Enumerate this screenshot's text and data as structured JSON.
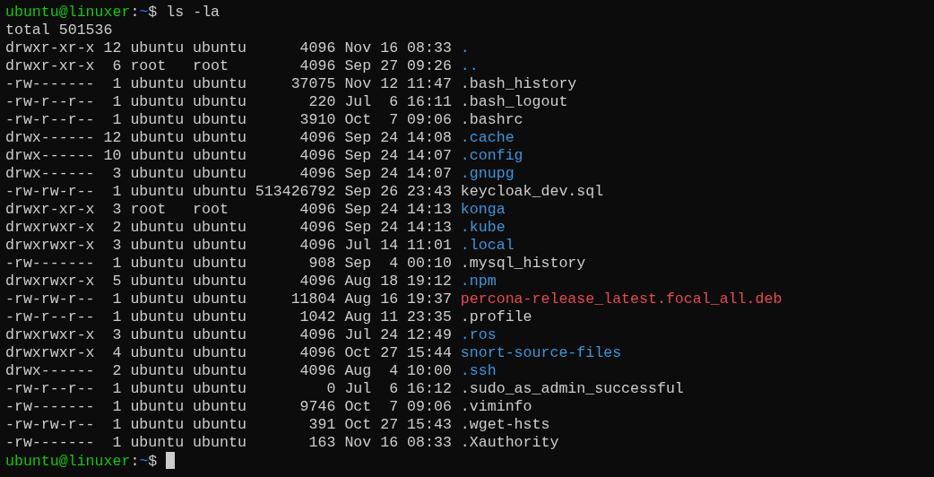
{
  "prompts": [
    {
      "user_host": "ubuntu@linuxer",
      "separator": ":",
      "path": "~",
      "symbol": "$",
      "command": "ls -la"
    }
  ],
  "total": "total 501536",
  "entries": [
    {
      "perms": "drwxr-xr-x",
      "links": "12",
      "owner": "ubuntu",
      "group": "ubuntu",
      "size": "4096",
      "month": "Nov",
      "day": "16",
      "time": "08:33",
      "name": ".",
      "kind": "dir"
    },
    {
      "perms": "drwxr-xr-x",
      "links": "6",
      "owner": "root",
      "group": "root",
      "size": "4096",
      "month": "Sep",
      "day": "27",
      "time": "09:26",
      "name": "..",
      "kind": "dir"
    },
    {
      "perms": "-rw-------",
      "links": "1",
      "owner": "ubuntu",
      "group": "ubuntu",
      "size": "37075",
      "month": "Nov",
      "day": "12",
      "time": "11:47",
      "name": ".bash_history",
      "kind": "file"
    },
    {
      "perms": "-rw-r--r--",
      "links": "1",
      "owner": "ubuntu",
      "group": "ubuntu",
      "size": "220",
      "month": "Jul",
      "day": "6",
      "time": "16:11",
      "name": ".bash_logout",
      "kind": "file"
    },
    {
      "perms": "-rw-r--r--",
      "links": "1",
      "owner": "ubuntu",
      "group": "ubuntu",
      "size": "3910",
      "month": "Oct",
      "day": "7",
      "time": "09:06",
      "name": ".bashrc",
      "kind": "file"
    },
    {
      "perms": "drwx------",
      "links": "12",
      "owner": "ubuntu",
      "group": "ubuntu",
      "size": "4096",
      "month": "Sep",
      "day": "24",
      "time": "14:08",
      "name": ".cache",
      "kind": "dir"
    },
    {
      "perms": "drwx------",
      "links": "10",
      "owner": "ubuntu",
      "group": "ubuntu",
      "size": "4096",
      "month": "Sep",
      "day": "24",
      "time": "14:07",
      "name": ".config",
      "kind": "dir"
    },
    {
      "perms": "drwx------",
      "links": "3",
      "owner": "ubuntu",
      "group": "ubuntu",
      "size": "4096",
      "month": "Sep",
      "day": "24",
      "time": "14:07",
      "name": ".gnupg",
      "kind": "dir"
    },
    {
      "perms": "-rw-rw-r--",
      "links": "1",
      "owner": "ubuntu",
      "group": "ubuntu",
      "size": "513426792",
      "month": "Sep",
      "day": "26",
      "time": "23:43",
      "name": "keycloak_dev.sql",
      "kind": "file"
    },
    {
      "perms": "drwxr-xr-x",
      "links": "3",
      "owner": "root",
      "group": "root",
      "size": "4096",
      "month": "Sep",
      "day": "24",
      "time": "14:13",
      "name": "konga",
      "kind": "dir"
    },
    {
      "perms": "drwxrwxr-x",
      "links": "2",
      "owner": "ubuntu",
      "group": "ubuntu",
      "size": "4096",
      "month": "Sep",
      "day": "24",
      "time": "14:13",
      "name": ".kube",
      "kind": "dir"
    },
    {
      "perms": "drwxrwxr-x",
      "links": "3",
      "owner": "ubuntu",
      "group": "ubuntu",
      "size": "4096",
      "month": "Jul",
      "day": "14",
      "time": "11:01",
      "name": ".local",
      "kind": "dir"
    },
    {
      "perms": "-rw-------",
      "links": "1",
      "owner": "ubuntu",
      "group": "ubuntu",
      "size": "908",
      "month": "Sep",
      "day": "4",
      "time": "00:10",
      "name": ".mysql_history",
      "kind": "file"
    },
    {
      "perms": "drwxrwxr-x",
      "links": "5",
      "owner": "ubuntu",
      "group": "ubuntu",
      "size": "4096",
      "month": "Aug",
      "day": "18",
      "time": "19:12",
      "name": ".npm",
      "kind": "dir"
    },
    {
      "perms": "-rw-rw-r--",
      "links": "1",
      "owner": "ubuntu",
      "group": "ubuntu",
      "size": "11804",
      "month": "Aug",
      "day": "16",
      "time": "19:37",
      "name": "percona-release_latest.focal_all.deb",
      "kind": "archive"
    },
    {
      "perms": "-rw-r--r--",
      "links": "1",
      "owner": "ubuntu",
      "group": "ubuntu",
      "size": "1042",
      "month": "Aug",
      "day": "11",
      "time": "23:35",
      "name": ".profile",
      "kind": "file"
    },
    {
      "perms": "drwxrwxr-x",
      "links": "3",
      "owner": "ubuntu",
      "group": "ubuntu",
      "size": "4096",
      "month": "Jul",
      "day": "24",
      "time": "12:49",
      "name": ".ros",
      "kind": "dir"
    },
    {
      "perms": "drwxrwxr-x",
      "links": "4",
      "owner": "ubuntu",
      "group": "ubuntu",
      "size": "4096",
      "month": "Oct",
      "day": "27",
      "time": "15:44",
      "name": "snort-source-files",
      "kind": "dir"
    },
    {
      "perms": "drwx------",
      "links": "2",
      "owner": "ubuntu",
      "group": "ubuntu",
      "size": "4096",
      "month": "Aug",
      "day": "4",
      "time": "10:00",
      "name": ".ssh",
      "kind": "dir"
    },
    {
      "perms": "-rw-r--r--",
      "links": "1",
      "owner": "ubuntu",
      "group": "ubuntu",
      "size": "0",
      "month": "Jul",
      "day": "6",
      "time": "16:12",
      "name": ".sudo_as_admin_successful",
      "kind": "file"
    },
    {
      "perms": "-rw-------",
      "links": "1",
      "owner": "ubuntu",
      "group": "ubuntu",
      "size": "9746",
      "month": "Oct",
      "day": "7",
      "time": "09:06",
      "name": ".viminfo",
      "kind": "file"
    },
    {
      "perms": "-rw-rw-r--",
      "links": "1",
      "owner": "ubuntu",
      "group": "ubuntu",
      "size": "391",
      "month": "Oct",
      "day": "27",
      "time": "15:43",
      "name": ".wget-hsts",
      "kind": "file"
    },
    {
      "perms": "-rw-------",
      "links": "1",
      "owner": "ubuntu",
      "group": "ubuntu",
      "size": "163",
      "month": "Nov",
      "day": "16",
      "time": "08:33",
      "name": ".Xauthority",
      "kind": "file"
    }
  ],
  "final_prompt": {
    "user_host": "ubuntu@linuxer",
    "separator": ":",
    "path": "~",
    "symbol": "$"
  }
}
